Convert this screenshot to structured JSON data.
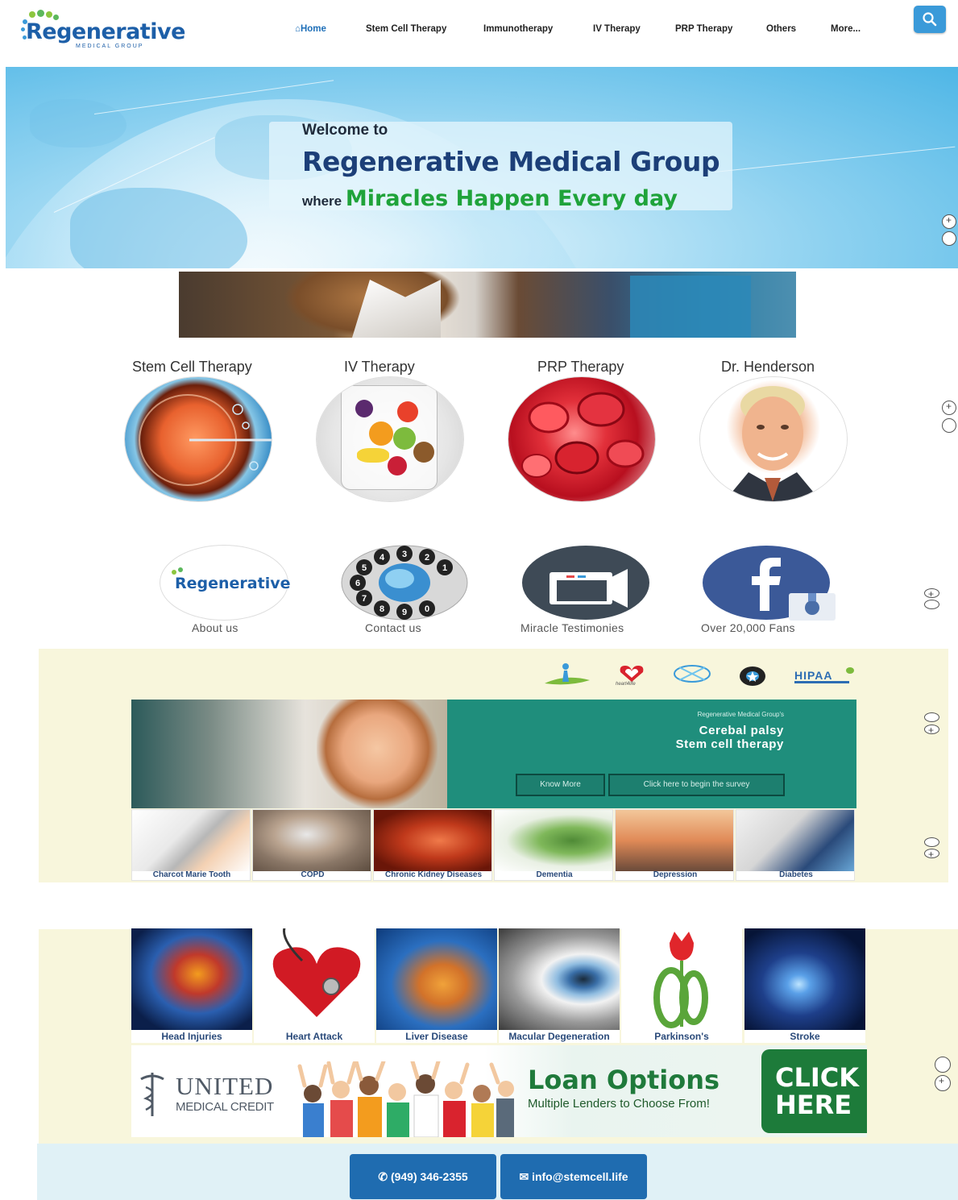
{
  "header": {
    "logo_text": "Regenerative",
    "logo_subtext": "MEDICAL GROUP",
    "nav": [
      {
        "label": "Home",
        "icon": "home-icon"
      },
      {
        "label": "Stem Cell Therapy"
      },
      {
        "label": "Immunotherapy"
      },
      {
        "label": "IV Therapy"
      },
      {
        "label": "PRP Therapy"
      },
      {
        "label": "Others"
      },
      {
        "label": "More..."
      }
    ],
    "search_icon": "search-icon"
  },
  "hero": {
    "line1": "Welcome to",
    "line2": "Regenerative Medical Group",
    "line3_prefix": "where",
    "line3_highlight": "Miracles Happen Every day"
  },
  "services": [
    {
      "title": "Stem Cell Therapy"
    },
    {
      "title": "IV Therapy"
    },
    {
      "title": "PRP Therapy"
    },
    {
      "title": "Dr. Henderson"
    }
  ],
  "links": [
    {
      "label": "About us",
      "icon": "regenerative-logo-icon",
      "logo_text": "Regenerative"
    },
    {
      "label": "Contact us",
      "icon": "rotary-phone-icon",
      "dial": [
        "1",
        "2",
        "3",
        "4",
        "5",
        "6",
        "7",
        "8",
        "9",
        "0"
      ]
    },
    {
      "label": "Miracle Testimonies",
      "icon": "video-camera-icon"
    },
    {
      "label": "Over 20,000 Fans",
      "icon": "facebook-icon"
    }
  ],
  "certifications": {
    "heart4life": "heart4life",
    "hipaa": "HIPAA"
  },
  "cp_banner": {
    "small": "Regenerative Medical Group's",
    "title_line1": "Cerebal palsy",
    "title_line2": "Stem cell therapy",
    "btn_know_more": "Know More",
    "btn_survey": "Click here to begin the survey"
  },
  "conditions_row1": [
    "Charcot Marie Tooth",
    "COPD",
    "Chronic Kidney Diseases",
    "Dementia",
    "Depression",
    "Diabetes"
  ],
  "conditions_row2": [
    "Head Injuries",
    "Heart Attack",
    "Liver Disease",
    "Macular Degeneration",
    "Parkinson's",
    "Stroke"
  ],
  "loan_banner": {
    "brand_line1": "UNITED",
    "brand_line2": "MEDICAL CREDIT",
    "headline": "Loan Options",
    "subline": "Multiple Lenders to Choose From!",
    "cta_line1": "CLICK",
    "cta_line2": "HERE"
  },
  "footer": {
    "phone": "(949) 346-2355",
    "email": "info@stemcell.life"
  },
  "colors": {
    "brand_blue": "#1d5fa8",
    "accent_green": "#1fa33a",
    "cream": "#f8f6dc",
    "footer_button": "#1f6cb0"
  }
}
